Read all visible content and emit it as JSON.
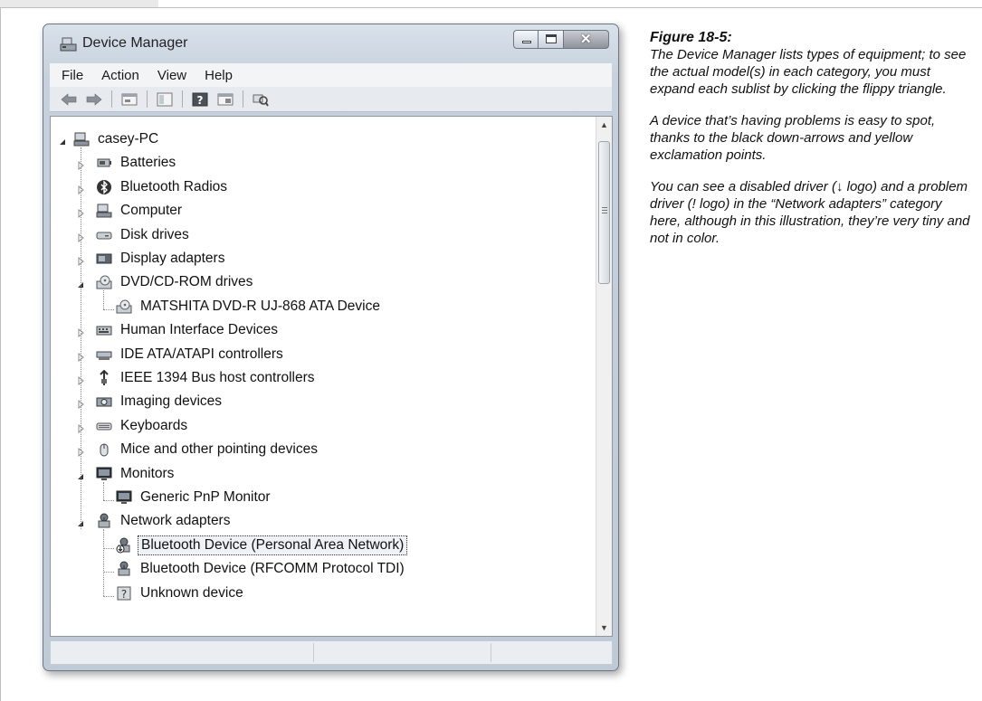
{
  "window": {
    "title": "Device Manager",
    "menu": [
      "File",
      "Action",
      "View",
      "Help"
    ],
    "toolbar_icons": [
      "back-arrow-icon",
      "forward-arrow-icon",
      "properties-icon",
      "show-hide-tree-icon",
      "help-icon",
      "details-pane-icon",
      "scan-hardware-icon"
    ]
  },
  "tree": [
    {
      "label": "casey-PC",
      "level": 0,
      "expanded": true,
      "icon": "computer-icon"
    },
    {
      "label": "Batteries",
      "level": 1,
      "expanded": false,
      "icon": "battery-icon"
    },
    {
      "label": "Bluetooth Radios",
      "level": 1,
      "expanded": false,
      "icon": "bluetooth-icon"
    },
    {
      "label": "Computer",
      "level": 1,
      "expanded": false,
      "icon": "computer-icon"
    },
    {
      "label": "Disk drives",
      "level": 1,
      "expanded": false,
      "icon": "disk-drive-icon"
    },
    {
      "label": "Display adapters",
      "level": 1,
      "expanded": false,
      "icon": "display-adapter-icon"
    },
    {
      "label": "DVD/CD-ROM drives",
      "level": 1,
      "expanded": true,
      "icon": "dvd-drive-icon"
    },
    {
      "label": "MATSHITA DVD-R   UJ-868 ATA Device",
      "level": 2,
      "icon": "dvd-drive-icon"
    },
    {
      "label": "Human Interface Devices",
      "level": 1,
      "expanded": false,
      "icon": "hid-icon"
    },
    {
      "label": "IDE ATA/ATAPI controllers",
      "level": 1,
      "expanded": false,
      "icon": "ide-controller-icon"
    },
    {
      "label": "IEEE 1394 Bus host controllers",
      "level": 1,
      "expanded": false,
      "icon": "ieee1394-icon"
    },
    {
      "label": "Imaging devices",
      "level": 1,
      "expanded": false,
      "icon": "imaging-device-icon"
    },
    {
      "label": "Keyboards",
      "level": 1,
      "expanded": false,
      "icon": "keyboard-icon"
    },
    {
      "label": "Mice and other pointing devices",
      "level": 1,
      "expanded": false,
      "icon": "mouse-icon"
    },
    {
      "label": "Monitors",
      "level": 1,
      "expanded": true,
      "icon": "monitor-icon"
    },
    {
      "label": "Generic PnP Monitor",
      "level": 2,
      "icon": "monitor-icon"
    },
    {
      "label": "Network adapters",
      "level": 1,
      "expanded": true,
      "icon": "network-adapter-icon"
    },
    {
      "label": "Bluetooth Device (Personal Area Network)",
      "level": 2,
      "icon": "disabled-network-adapter-icon",
      "selected": true
    },
    {
      "label": "Bluetooth Device (RFCOMM Protocol TDI)",
      "level": 2,
      "icon": "network-adapter-icon"
    },
    {
      "label": "Unknown device",
      "level": 2,
      "icon": "unknown-device-icon"
    }
  ],
  "caption": {
    "title": "Figure 18-5:",
    "paragraphs": [
      "The Device Manager lists types of equipment; to see the actual model(s) in each category, you must expand each sublist by clicking the flippy triangle.",
      "A device that’s having problems is easy to spot, thanks to the black down-arrows and yellow exclamation points.",
      "You can see a disabled driver (↓ logo) and a problem driver (! logo) in the “Network adapters” category here, although in this illustration, they’re very tiny and not in color."
    ]
  }
}
